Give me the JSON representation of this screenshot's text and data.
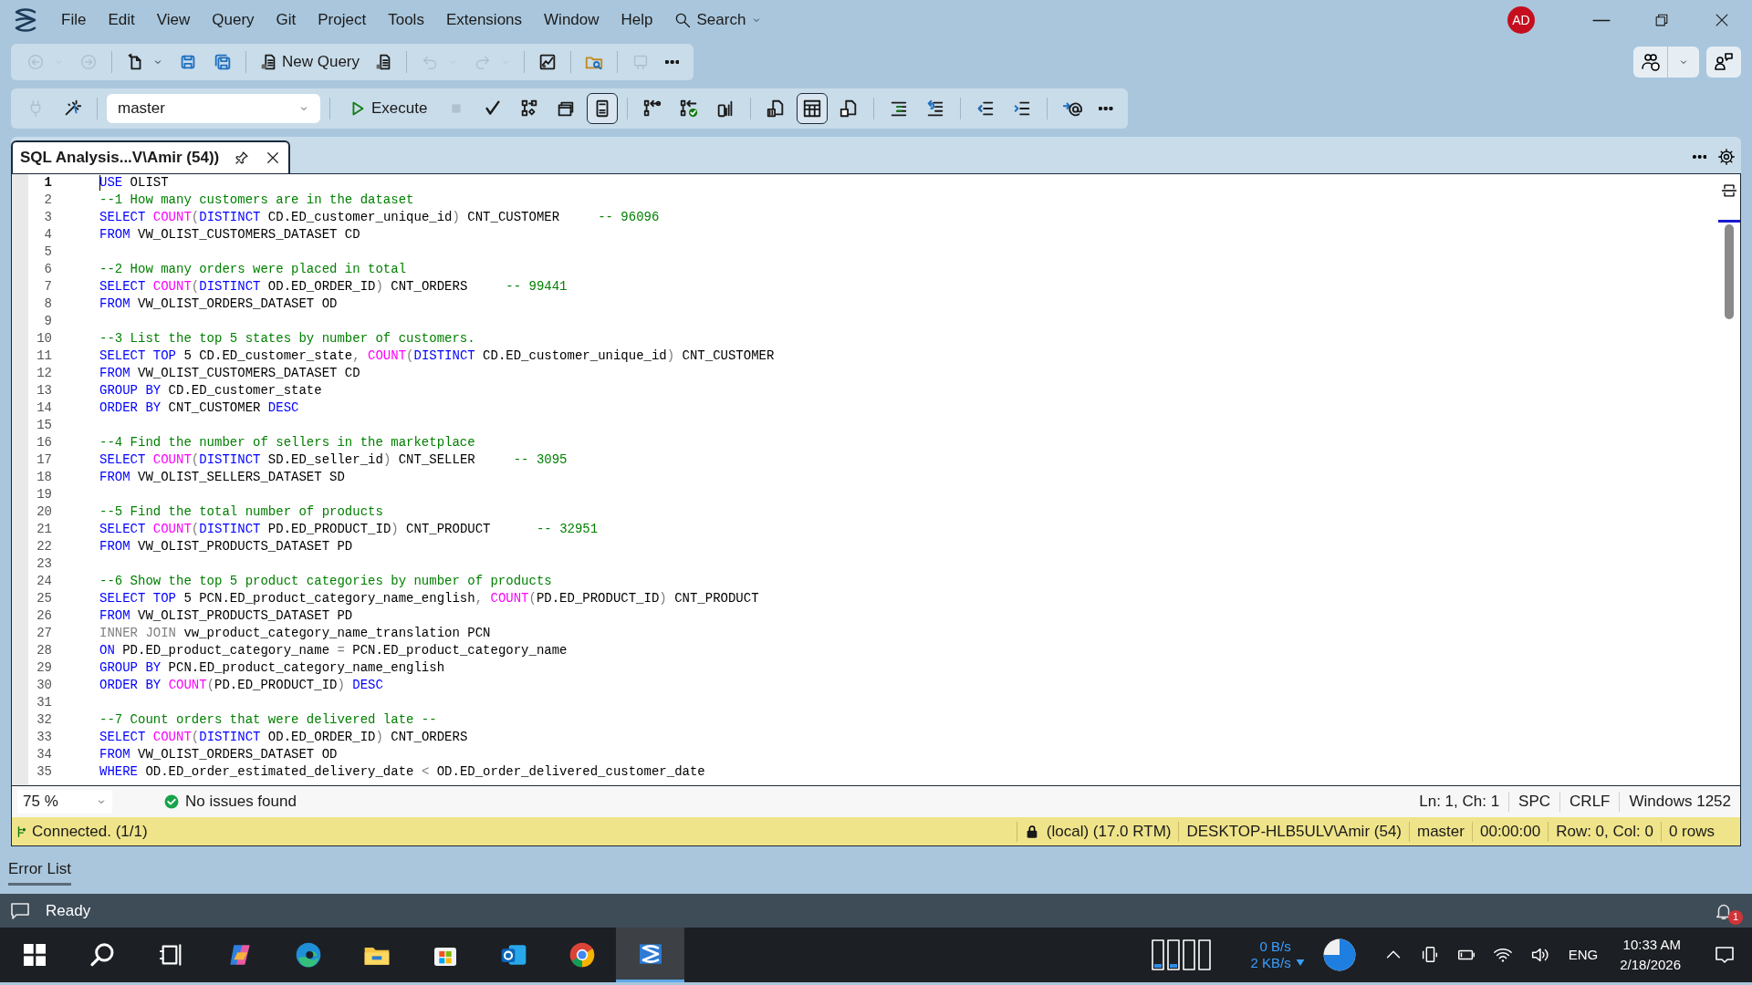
{
  "menu": [
    "File",
    "Edit",
    "View",
    "Query",
    "Git",
    "Project",
    "Tools",
    "Extensions",
    "Window",
    "Help"
  ],
  "search": {
    "label": "Search"
  },
  "account": {
    "initials": "AD"
  },
  "standard_toolbar": [
    {
      "kind": "back",
      "disabled": true,
      "dropdown": true
    },
    {
      "kind": "forward",
      "disabled": true
    },
    {
      "kind": "separator"
    },
    {
      "kind": "new-file",
      "disabled": false,
      "dropdown": true
    },
    {
      "kind": "save",
      "disabled": false
    },
    {
      "kind": "save-all",
      "disabled": false
    },
    {
      "kind": "separator"
    },
    {
      "kind": "new-query",
      "label": "New Query",
      "disabled": false
    },
    {
      "kind": "query-file",
      "disabled": false
    },
    {
      "kind": "separator"
    },
    {
      "kind": "undo",
      "disabled": true,
      "dropdown": true
    },
    {
      "kind": "redo",
      "disabled": true,
      "dropdown": true
    },
    {
      "kind": "separator"
    },
    {
      "kind": "monitor",
      "disabled": false
    },
    {
      "kind": "separator"
    },
    {
      "kind": "folder-search",
      "disabled": false
    },
    {
      "kind": "separator"
    },
    {
      "kind": "publish",
      "disabled": true
    },
    {
      "kind": "more",
      "disabled": false
    }
  ],
  "query_toolbar": [
    {
      "kind": "plug",
      "disabled": true,
      "selected": false
    },
    {
      "kind": "wand",
      "disabled": false,
      "selected": false
    },
    {
      "kind": "separator"
    },
    {
      "kind": "database",
      "value": "master"
    },
    {
      "kind": "separator"
    },
    {
      "kind": "execute",
      "label": "Execute",
      "disabled": false,
      "selected": false
    },
    {
      "kind": "stop",
      "disabled": true,
      "selected": false
    },
    {
      "kind": "check",
      "disabled": false
    },
    {
      "kind": "plan",
      "disabled": false,
      "selected": false
    },
    {
      "kind": "frame",
      "disabled": false,
      "selected": false
    },
    {
      "kind": "page",
      "disabled": false,
      "selected": true
    },
    {
      "kind": "separator"
    },
    {
      "kind": "link",
      "disabled": false,
      "selected": false
    },
    {
      "kind": "link-ok",
      "disabled": false,
      "selected": false
    },
    {
      "kind": "stats",
      "disabled": false,
      "selected": false
    },
    {
      "kind": "separator"
    },
    {
      "kind": "text-results",
      "disabled": false,
      "selected": false
    },
    {
      "kind": "grid",
      "disabled": false,
      "selected": true
    },
    {
      "kind": "file-results",
      "disabled": false,
      "selected": false
    },
    {
      "kind": "separator"
    },
    {
      "kind": "list-indent",
      "disabled": false,
      "selected": false
    },
    {
      "kind": "list-undo",
      "disabled": false,
      "selected": false
    },
    {
      "kind": "separator"
    },
    {
      "kind": "outdent",
      "disabled": false,
      "selected": false
    },
    {
      "kind": "indent",
      "disabled": false,
      "selected": false
    },
    {
      "kind": "separator"
    },
    {
      "kind": "at",
      "disabled": false,
      "selected": false
    },
    {
      "kind": "more",
      "disabled": false,
      "selected": false
    }
  ],
  "document_tab": {
    "title": "SQL Analysis...V\\Amir (54))"
  },
  "editor": {
    "lines": [
      {
        "number": "1",
        "current": true,
        "tokens": [
          {
            "kind": "keyword",
            "text": "USE"
          },
          {
            "kind": "identifier",
            "text": " OLIST"
          }
        ]
      },
      {
        "number": "2",
        "current": false,
        "tokens": [
          {
            "kind": "comment",
            "text": "--1 How many customers are in the dataset"
          }
        ]
      },
      {
        "number": "3",
        "current": false,
        "tokens": [
          {
            "kind": "keyword",
            "text": "SELECT "
          },
          {
            "kind": "function",
            "text": "COUNT"
          },
          {
            "kind": "operator",
            "text": "("
          },
          {
            "kind": "keyword",
            "text": "DISTINCT"
          },
          {
            "kind": "identifier",
            "text": " CD.ED_customer_unique_id"
          },
          {
            "kind": "operator",
            "text": ")"
          },
          {
            "kind": "identifier",
            "text": " CNT_CUSTOMER     "
          },
          {
            "kind": "comment",
            "text": "-- 96096"
          }
        ]
      },
      {
        "number": "4",
        "current": false,
        "tokens": [
          {
            "kind": "keyword",
            "text": "FROM"
          },
          {
            "kind": "identifier",
            "text": " VW_OLIST_CUSTOMERS_DATASET CD"
          }
        ]
      },
      {
        "number": "5",
        "current": false
      },
      {
        "number": "6",
        "current": false,
        "tokens": [
          {
            "kind": "comment",
            "text": "--2 How many orders were placed in total"
          }
        ]
      },
      {
        "number": "7",
        "current": false,
        "tokens": [
          {
            "kind": "keyword",
            "text": "SELECT "
          },
          {
            "kind": "function",
            "text": "COUNT"
          },
          {
            "kind": "operator",
            "text": "("
          },
          {
            "kind": "keyword",
            "text": "DISTINCT"
          },
          {
            "kind": "identifier",
            "text": " OD.ED_ORDER_ID"
          },
          {
            "kind": "operator",
            "text": ")"
          },
          {
            "kind": "identifier",
            "text": " CNT_ORDERS     "
          },
          {
            "kind": "comment",
            "text": "-- 99441"
          }
        ]
      },
      {
        "number": "8",
        "current": false,
        "tokens": [
          {
            "kind": "keyword",
            "text": "FROM"
          },
          {
            "kind": "identifier",
            "text": " VW_OLIST_ORDERS_DATASET OD"
          }
        ]
      },
      {
        "number": "9",
        "current": false
      },
      {
        "number": "10",
        "current": false,
        "tokens": [
          {
            "kind": "comment",
            "text": "--3 List the top 5 states by number of customers."
          }
        ]
      },
      {
        "number": "11",
        "current": false,
        "tokens": [
          {
            "kind": "keyword",
            "text": "SELECT TOP"
          },
          {
            "kind": "identifier",
            "text": " 5 CD.ED_customer_state"
          },
          {
            "kind": "operator",
            "text": ", "
          },
          {
            "kind": "function",
            "text": "COUNT"
          },
          {
            "kind": "operator",
            "text": "("
          },
          {
            "kind": "keyword",
            "text": "DISTINCT"
          },
          {
            "kind": "identifier",
            "text": " CD.ED_customer_unique_id"
          },
          {
            "kind": "operator",
            "text": ")"
          },
          {
            "kind": "identifier",
            "text": " CNT_CUSTOMER"
          }
        ]
      },
      {
        "number": "12",
        "current": false,
        "tokens": [
          {
            "kind": "keyword",
            "text": "FROM"
          },
          {
            "kind": "identifier",
            "text": " VW_OLIST_CUSTOMERS_DATASET CD"
          }
        ]
      },
      {
        "number": "13",
        "current": false,
        "tokens": [
          {
            "kind": "keyword",
            "text": "GROUP BY"
          },
          {
            "kind": "identifier",
            "text": " CD.ED_customer_state"
          }
        ]
      },
      {
        "number": "14",
        "current": false,
        "tokens": [
          {
            "kind": "keyword",
            "text": "ORDER BY"
          },
          {
            "kind": "identifier",
            "text": " CNT_CUSTOMER "
          },
          {
            "kind": "keyword",
            "text": "DESC"
          }
        ]
      },
      {
        "number": "15",
        "current": false
      },
      {
        "number": "16",
        "current": false,
        "tokens": [
          {
            "kind": "comment",
            "text": "--4 Find the number of sellers in the marketplace"
          }
        ]
      },
      {
        "number": "17",
        "current": false,
        "tokens": [
          {
            "kind": "keyword",
            "text": "SELECT "
          },
          {
            "kind": "function",
            "text": "COUNT"
          },
          {
            "kind": "operator",
            "text": "("
          },
          {
            "kind": "keyword",
            "text": "DISTINCT"
          },
          {
            "kind": "identifier",
            "text": " SD.ED_seller_id"
          },
          {
            "kind": "operator",
            "text": ")"
          },
          {
            "kind": "identifier",
            "text": " CNT_SELLER     "
          },
          {
            "kind": "comment",
            "text": "-- 3095"
          }
        ]
      },
      {
        "number": "18",
        "current": false,
        "tokens": [
          {
            "kind": "keyword",
            "text": "FROM"
          },
          {
            "kind": "identifier",
            "text": " VW_OLIST_SELLERS_DATASET SD"
          }
        ]
      },
      {
        "number": "19",
        "current": false
      },
      {
        "number": "20",
        "current": false,
        "tokens": [
          {
            "kind": "comment",
            "text": "--5 Find the total number of products"
          }
        ]
      },
      {
        "number": "21",
        "current": false,
        "tokens": [
          {
            "kind": "keyword",
            "text": "SELECT "
          },
          {
            "kind": "function",
            "text": "COUNT"
          },
          {
            "kind": "operator",
            "text": "("
          },
          {
            "kind": "keyword",
            "text": "DISTINCT"
          },
          {
            "kind": "identifier",
            "text": " PD.ED_PRODUCT_ID"
          },
          {
            "kind": "operator",
            "text": ")"
          },
          {
            "kind": "identifier",
            "text": " CNT_PRODUCT      "
          },
          {
            "kind": "comment",
            "text": "-- 32951"
          }
        ]
      },
      {
        "number": "22",
        "current": false,
        "tokens": [
          {
            "kind": "keyword",
            "text": "FROM"
          },
          {
            "kind": "identifier",
            "text": " VW_OLIST_PRODUCTS_DATASET PD"
          }
        ]
      },
      {
        "number": "23",
        "current": false
      },
      {
        "number": "24",
        "current": false,
        "tokens": [
          {
            "kind": "comment",
            "text": "--6 Show the top 5 product categories by number of products"
          }
        ]
      },
      {
        "number": "25",
        "current": false,
        "tokens": [
          {
            "kind": "keyword",
            "text": "SELECT TOP"
          },
          {
            "kind": "identifier",
            "text": " 5 PCN.ED_product_category_name_english"
          },
          {
            "kind": "operator",
            "text": ", "
          },
          {
            "kind": "function",
            "text": "COUNT"
          },
          {
            "kind": "operator",
            "text": "("
          },
          {
            "kind": "identifier",
            "text": "PD.ED_PRODUCT_ID"
          },
          {
            "kind": "operator",
            "text": ")"
          },
          {
            "kind": "identifier",
            "text": " CNT_PRODUCT"
          }
        ]
      },
      {
        "number": "26",
        "current": false,
        "tokens": [
          {
            "kind": "keyword",
            "text": "FROM"
          },
          {
            "kind": "identifier",
            "text": " VW_OLIST_PRODUCTS_DATASET PD"
          }
        ]
      },
      {
        "number": "27",
        "current": false,
        "tokens": [
          {
            "kind": "operator",
            "text": "INNER JOIN"
          },
          {
            "kind": "identifier",
            "text": " vw_product_category_name_translation PCN"
          }
        ]
      },
      {
        "number": "28",
        "current": false,
        "tokens": [
          {
            "kind": "keyword",
            "text": "ON"
          },
          {
            "kind": "identifier",
            "text": " PD.ED_product_category_name "
          },
          {
            "kind": "operator",
            "text": "="
          },
          {
            "kind": "identifier",
            "text": " PCN.ED_product_category_name"
          }
        ]
      },
      {
        "number": "29",
        "current": false,
        "tokens": [
          {
            "kind": "keyword",
            "text": "GROUP BY"
          },
          {
            "kind": "identifier",
            "text": " PCN.ED_product_category_name_english"
          }
        ]
      },
      {
        "number": "30",
        "current": false,
        "tokens": [
          {
            "kind": "keyword",
            "text": "ORDER BY "
          },
          {
            "kind": "function",
            "text": "COUNT"
          },
          {
            "kind": "operator",
            "text": "("
          },
          {
            "kind": "identifier",
            "text": "PD.ED_PRODUCT_ID"
          },
          {
            "kind": "operator",
            "text": ") "
          },
          {
            "kind": "keyword",
            "text": "DESC"
          }
        ]
      },
      {
        "number": "31",
        "current": false
      },
      {
        "number": "32",
        "current": false,
        "tokens": [
          {
            "kind": "comment",
            "text": "--7 Count orders that were delivered late --"
          }
        ]
      },
      {
        "number": "33",
        "current": false,
        "tokens": [
          {
            "kind": "keyword",
            "text": "SELECT "
          },
          {
            "kind": "function",
            "text": "COUNT"
          },
          {
            "kind": "operator",
            "text": "("
          },
          {
            "kind": "keyword",
            "text": "DISTINCT"
          },
          {
            "kind": "identifier",
            "text": " OD.ED_ORDER_ID"
          },
          {
            "kind": "operator",
            "text": ")"
          },
          {
            "kind": "identifier",
            "text": " CNT_ORDERS"
          }
        ]
      },
      {
        "number": "34",
        "current": false,
        "tokens": [
          {
            "kind": "keyword",
            "text": "FROM"
          },
          {
            "kind": "identifier",
            "text": " VW_OLIST_ORDERS_DATASET OD"
          }
        ]
      },
      {
        "number": "35",
        "current": false,
        "tokens": [
          {
            "kind": "keyword",
            "text": "WHERE"
          },
          {
            "kind": "identifier",
            "text": " OD.ED_order_estimated_delivery_date "
          },
          {
            "kind": "operator",
            "text": "<"
          },
          {
            "kind": "identifier",
            "text": " OD.ED_order_delivered_customer_date"
          }
        ]
      }
    ]
  },
  "editor_status": {
    "zoom": "75 %",
    "issues": "No issues found",
    "items": [
      "Ln: 1, Ch: 1",
      "SPC",
      "CRLF",
      "Windows 1252"
    ]
  },
  "connection_bar": {
    "status": "Connected. (1/1)",
    "items": [
      "(local) (17.0 RTM)",
      "DESKTOP-HLB5ULV\\Amir (54)",
      "master",
      "00:00:00",
      "Row: 0, Col: 0",
      "0 rows"
    ]
  },
  "bottom_panel_tabs": [
    {
      "label": "Error List",
      "selected": true
    }
  ],
  "status_bar": {
    "text": "Ready",
    "notification_count": "1"
  },
  "taskbar": {
    "apps": [
      {
        "kind": "start",
        "selected": false
      },
      {
        "kind": "search",
        "selected": false
      },
      {
        "kind": "task-view",
        "selected": false
      },
      {
        "kind": "copilot",
        "selected": false
      },
      {
        "kind": "edge",
        "selected": false
      },
      {
        "kind": "explorer",
        "selected": false
      },
      {
        "kind": "store",
        "selected": false
      },
      {
        "kind": "outlook",
        "selected": false
      },
      {
        "kind": "chrome",
        "selected": false
      },
      {
        "kind": "ssms",
        "selected": true
      }
    ],
    "network": {
      "up": "0 B/s",
      "down": "2 KB/s"
    },
    "language": "ENG",
    "time": "10:33 AM",
    "date": "2/18/2026"
  }
}
